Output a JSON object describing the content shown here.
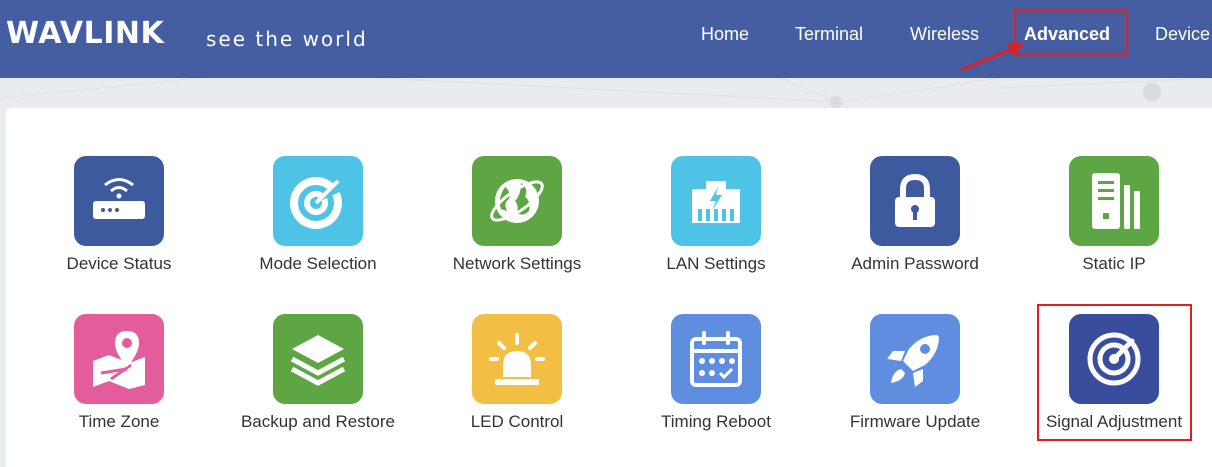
{
  "header": {
    "logo": "WAVLINK",
    "tagline": "see the world",
    "nav": [
      "Home",
      "Terminal",
      "Wireless",
      "Advanced",
      "Device"
    ],
    "active": "Advanced",
    "bg_color": "#455ea1"
  },
  "tiles": [
    {
      "label": "Device Status",
      "icon": "router-icon",
      "color": "#3e5a9e"
    },
    {
      "label": "Mode Selection",
      "icon": "target-icon",
      "color": "#4ec3e6"
    },
    {
      "label": "Network Settings",
      "icon": "globe-icon",
      "color": "#5ea543"
    },
    {
      "label": "LAN Settings",
      "icon": "ethernet-port-icon",
      "color": "#4ec3e6"
    },
    {
      "label": "Admin Password",
      "icon": "lock-icon",
      "color": "#3e5a9e"
    },
    {
      "label": "Static IP",
      "icon": "server-icon",
      "color": "#5ea543"
    },
    {
      "label": "Time Zone",
      "icon": "map-pin-icon",
      "color": "#e35d9d"
    },
    {
      "label": "Backup and Restore",
      "icon": "layers-icon",
      "color": "#5ea543"
    },
    {
      "label": "LED Control",
      "icon": "alarm-light-icon",
      "color": "#f2bf44"
    },
    {
      "label": "Timing Reboot",
      "icon": "calendar-icon",
      "color": "#5f8de0"
    },
    {
      "label": "Firmware Update",
      "icon": "rocket-icon",
      "color": "#5f8de0"
    },
    {
      "label": "Signal Adjustment",
      "icon": "gauge-icon",
      "color": "#3a4c9c"
    }
  ],
  "annotation_color": "#e02020"
}
